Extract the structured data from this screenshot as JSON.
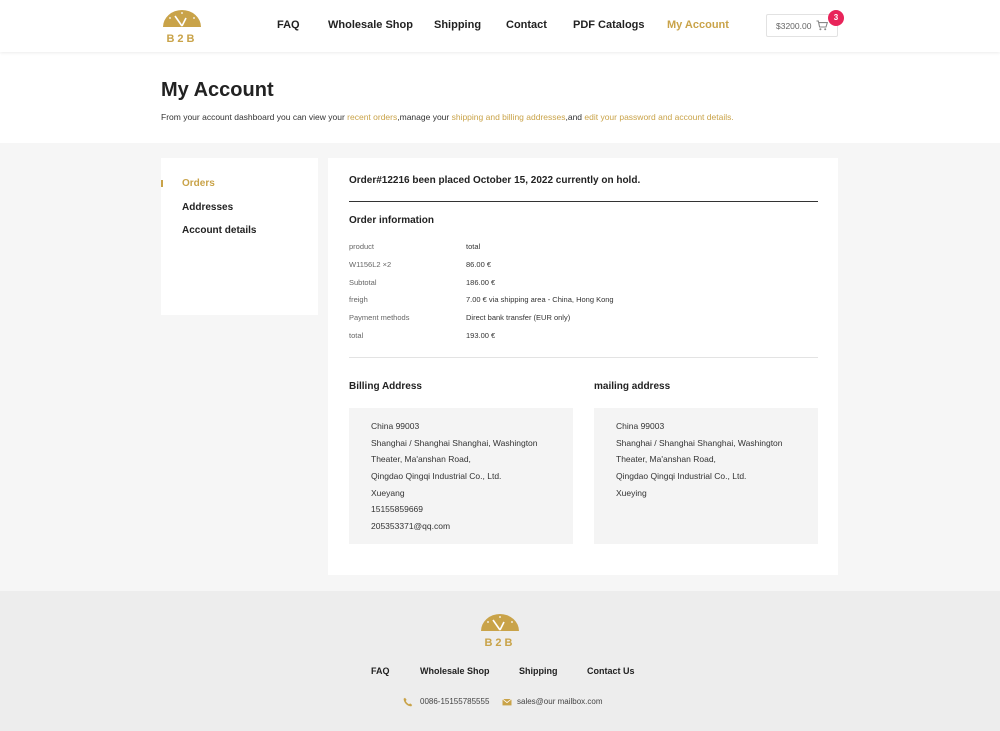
{
  "header": {
    "logo_text": "B2B",
    "nav": [
      "FAQ",
      "Wholesale Shop",
      "Shipping",
      "Contact",
      "PDF Catalogs",
      "My Account"
    ],
    "active_nav": "My Account",
    "cart_total": "$3200.00",
    "cart_count": "3"
  },
  "page": {
    "title": "My Account",
    "intro_prefix": "From your account dashboard you can view your ",
    "intro_link1": "recent orders",
    "intro_mid1": ",manage your ",
    "intro_link2": "shipping and billing addresses",
    "intro_mid2": ",and ",
    "intro_link3": "edit your password and account details."
  },
  "sidebar": {
    "items": [
      "Orders",
      "Addresses",
      "Account details"
    ],
    "active": "Orders"
  },
  "order": {
    "heading": "Order#12216 been placed October 15, 2022 currently on hold.",
    "info_title": "Order information",
    "rows": [
      {
        "label": "product",
        "value": "total"
      },
      {
        "label": "W1156L2 ×2",
        "value": "86.00  €"
      },
      {
        "label": "Subtotal",
        "value": "186.00  €"
      },
      {
        "label": "freigh",
        "value": "7.00  €  via shipping area - China, Hong Kong"
      },
      {
        "label": "Payment methods",
        "value": "Direct bank transfer (EUR only)"
      },
      {
        "label": "total",
        "value": "193.00  €"
      }
    ]
  },
  "billing": {
    "title": "Billing Address",
    "lines": [
      "China 99003",
      "Shanghai / Shanghai Shanghai, Washington",
      "Theater, Ma'anshan Road,",
      "Qingdao Qingqi Industrial Co., Ltd.",
      "Xueyang",
      "15155859669",
      "205353371@qq.com"
    ]
  },
  "mailing": {
    "title": "mailing address",
    "lines": [
      "China 99003",
      "Shanghai / Shanghai Shanghai, Washington",
      "Theater, Ma'anshan Road,",
      "Qingdao Qingqi Industrial Co., Ltd.",
      "Xueying"
    ]
  },
  "footer": {
    "logo_text": "B2B",
    "nav": [
      "FAQ",
      "Wholesale Shop",
      "Shipping",
      "Contact Us"
    ],
    "phone": "0086-15155785555",
    "email": "sales@our mailbox.com"
  },
  "colors": {
    "accent": "#c9a349",
    "badge": "#e8245a"
  }
}
